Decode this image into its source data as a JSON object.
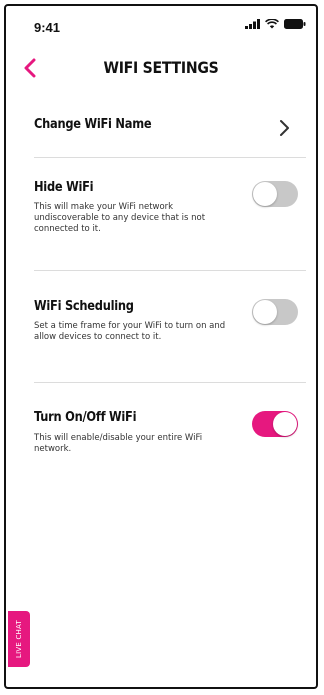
{
  "status_bar": {
    "time": "9:41",
    "icons": [
      "signal-icon",
      "wifi-icon",
      "battery-icon"
    ]
  },
  "header": {
    "back_icon": "chevron-left-icon",
    "title": "WIFI SETTINGS"
  },
  "settings": {
    "change_name": {
      "title": "Change WiFi Name",
      "icon": "chevron-right-icon"
    },
    "hide_wifi": {
      "title": "Hide WiFi",
      "description": "This will make your WiFi network undiscoverable to any device that is not connected to it.",
      "enabled": false
    },
    "scheduling": {
      "title": "WiFi Scheduling",
      "description": "Set a time frame for your WiFi to turn on and allow devices to connect to it.",
      "enabled": false
    },
    "on_off": {
      "title": "Turn On/Off WiFi",
      "description": "This will enable/disable your entire WiFi network.",
      "enabled": true
    }
  },
  "live_chat": {
    "label": "LIVE CHAT"
  },
  "colors": {
    "accent": "#e6187f",
    "toggle_off": "#c8c8c8",
    "divider": "#dcdcdc",
    "text": "#111111"
  }
}
